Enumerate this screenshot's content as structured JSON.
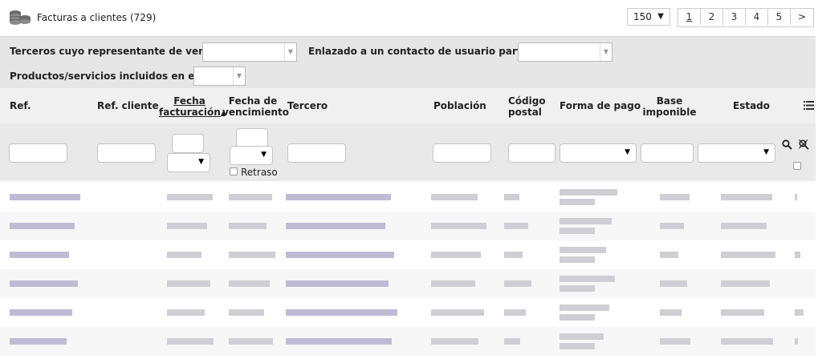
{
  "header": {
    "title": "Facturas a clientes (729)",
    "page_size": "150",
    "pages": [
      "1",
      "2",
      "3",
      "4",
      "5"
    ],
    "next": ">",
    "current_page": "1"
  },
  "filters": {
    "sales_rep_label": "Terceros cuyo representante de ventas es:",
    "user_contact_label": "Enlazado a un contacto de usuario particular:",
    "tag_label": "Productos/servicios incluidos en el tag:"
  },
  "columns": {
    "ref": "Ref.",
    "ref_cliente": "Ref. cliente",
    "fecha_line1": "Fecha",
    "fecha_line2": "facturación",
    "sort_indicator": "▲",
    "venc_line1": "Fecha de",
    "venc_line2": "vencimiento",
    "tercero": "Tercero",
    "poblacion": "Población",
    "cp_line1": "Código",
    "cp_line2": "postal",
    "forma_pago": "Forma de pago",
    "base_line1": "Base",
    "base_line2": "imponible",
    "estado": "Estado"
  },
  "filter_row": {
    "retraso_label": "Retraso"
  },
  "icons": {
    "title": "coins-stack-icon",
    "columns_menu": "list-icon",
    "search": "search-icon",
    "clear": "clear-filter-icon"
  },
  "colors": {
    "filter_bg": "#e6e6e6",
    "header_bg": "#f0f0f0",
    "blurred_text": "#c9c9cf",
    "blurred_link": "#b9b4d0"
  }
}
